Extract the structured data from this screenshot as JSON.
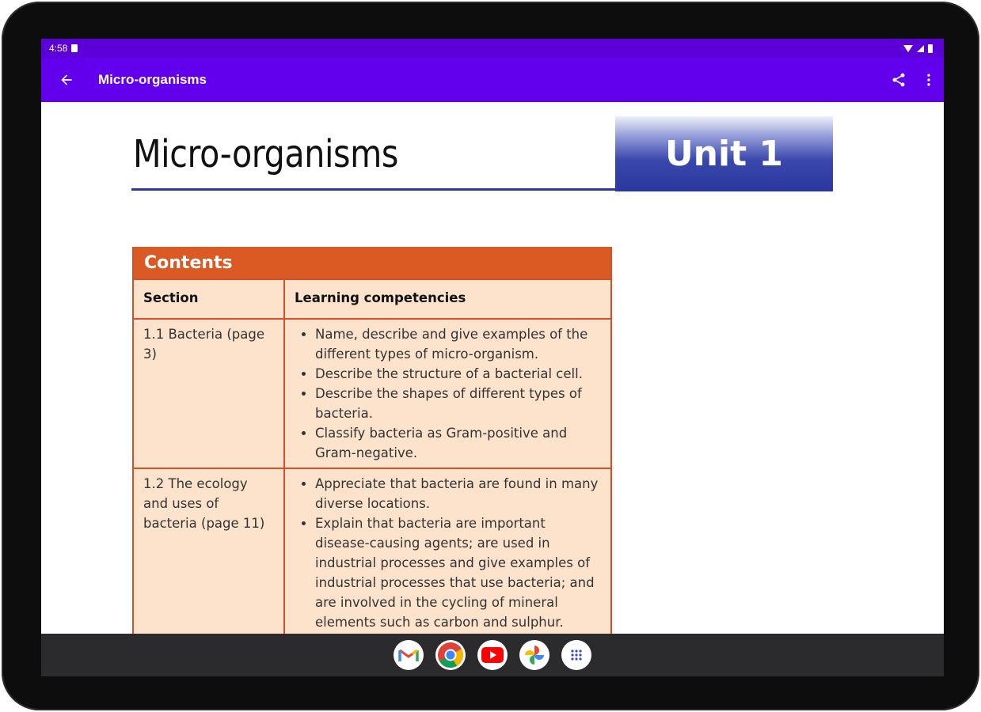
{
  "status_bar": {
    "time": "4:58"
  },
  "app_bar": {
    "title": "Micro-organisms",
    "icons": [
      "arrow-back-icon",
      "share-icon",
      "more-vert-icon"
    ],
    "color": "#6200ee"
  },
  "document": {
    "title": "Micro-organisms",
    "unit": "Unit 1",
    "contents": {
      "heading": "Contents",
      "columns": [
        "Section",
        "Learning competencies"
      ],
      "rows": [
        {
          "section": "1.1 Bacteria (page 3)",
          "competencies": [
            "Name, describe and give examples of the different types of micro-organism.",
            "Describe the structure of a bacterial cell.",
            "Describe the shapes of different types of bacteria.",
            "Classify bacteria as Gram-positive and Gram-negative."
          ]
        },
        {
          "section": "1.2 The ecology and uses of bacteria (page 11)",
          "competencies": [
            "Appreciate that bacteria are found in many diverse locations.",
            "Explain that bacteria are important disease-causing agents; are used in industrial processes and give examples of industrial processes that use bacteria; and are involved in the cycling of mineral elements such as carbon and sulphur."
          ]
        }
      ]
    }
  },
  "dock": {
    "apps": [
      "gmail-icon",
      "chrome-icon",
      "youtube-icon",
      "photos-icon",
      "app-drawer-icon"
    ]
  }
}
